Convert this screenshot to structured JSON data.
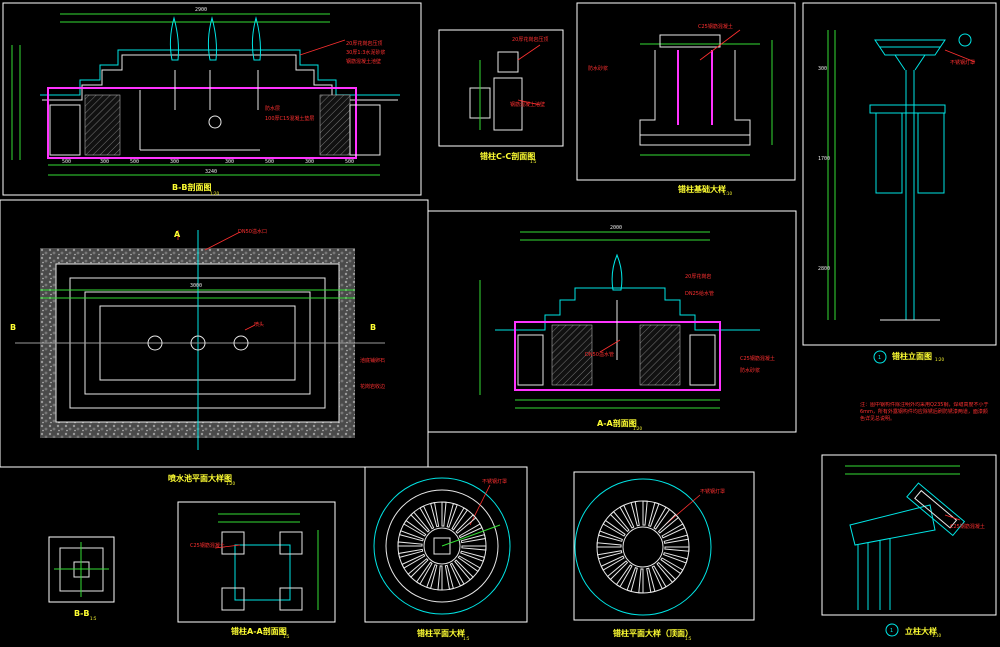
{
  "drawing": {
    "background": "#000000",
    "colors": {
      "frame": "#ffffff",
      "cyan": "#00e5e5",
      "green": "#33dd33",
      "red": "#ff3030",
      "magenta": "#ff33ff",
      "yellow": "#ffff33"
    }
  },
  "titles": {
    "b_section": "B-B剖面图",
    "b_section_scale": "1:20",
    "c_section": "错柱C-C剖面图",
    "c_section_scale": "1:5",
    "footing": "错柱基础大样",
    "footing_scale": "1:10",
    "pool_plan": "喷水池平面大样图",
    "pool_plan_scale": "1:20",
    "a_section": "A-A剖面图",
    "a_section_scale": "1:20",
    "lamp_elev": "错柱立面图",
    "lamp_elev_scale": "1:20",
    "small_b": "B-B",
    "small_b_scale": "1:5",
    "lamp_aa": "错柱A-A剖面图",
    "lamp_aa_scale": "1:5",
    "lamp_top": "错柱平面大样",
    "lamp_top_scale": "1:5",
    "lamp_top2": "错柱平面大样（顶面）",
    "lamp_top2_scale": "1:5",
    "post_detail": "立柱大样",
    "post_detail_scale": "1:10"
  },
  "circle_marks": {
    "lamp_elev": "1",
    "post_detail": "1"
  },
  "dims": {
    "b_top": "2900",
    "b_bottom": [
      "500",
      "300",
      "500",
      "300",
      "300",
      "500",
      "300",
      "500"
    ],
    "b_total": "3240",
    "a_top": "2000",
    "pool_top": "3000",
    "lamp_left": [
      "300",
      "1700",
      "2800"
    ]
  },
  "section_marks": {
    "a": "A",
    "b": "B",
    "b2": "B"
  },
  "notes": {
    "general": "注：图中钢构件除注明外均采用Q235钢，焊缝高度不小于6mm，所有外露钢构件均应除锈后刷防锈漆两道，面漆颜色详见总说明。",
    "b_notes": [
      "20厚花岗岩压顶",
      "30厚1:3水泥砂浆",
      "钢筋混凝土池壁",
      "防水层",
      "100厚C15混凝土垫层"
    ],
    "a_notes": [
      "20厚花岗岩",
      "DN50溢水管",
      "DN25给水管",
      "C25钢筋混凝土",
      "防水砂浆"
    ],
    "pool_notes": [
      "DN50溢水口",
      "池底铺卵石",
      "花岗岩收边",
      "喷头"
    ],
    "lamp_note": "不锈钢灯罩"
  }
}
